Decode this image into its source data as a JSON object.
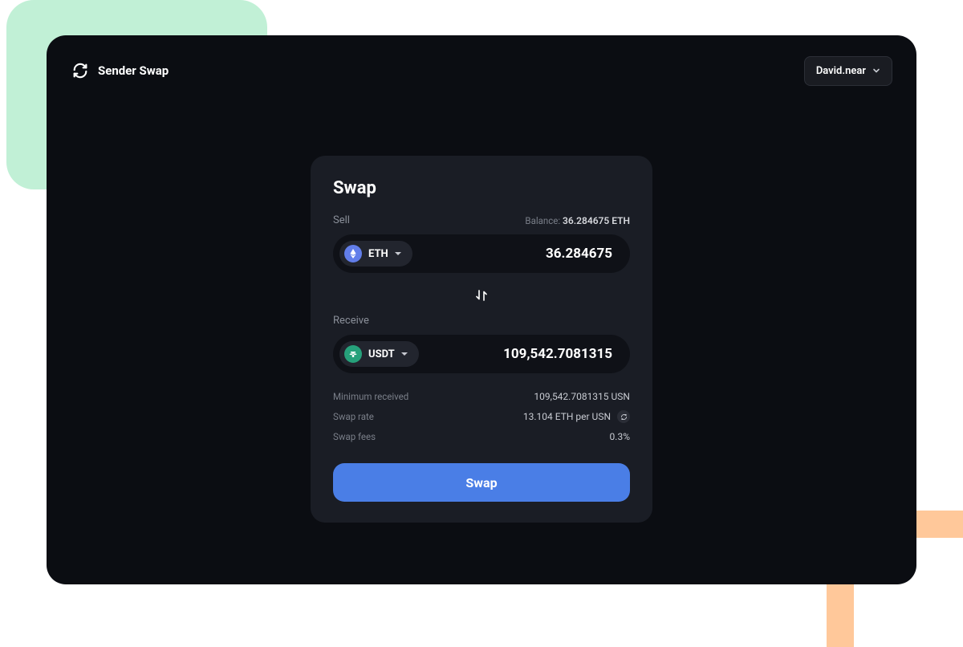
{
  "header": {
    "app_title": "Sender Swap",
    "account_label": "David.near"
  },
  "swap": {
    "title": "Swap",
    "sell": {
      "label": "Sell",
      "balance_label": "Balance:",
      "balance_value": "36.284675 ETH",
      "token_symbol": "ETH",
      "amount": "36.284675"
    },
    "receive": {
      "label": "Receive",
      "token_symbol": "USDT",
      "amount": "109,542.7081315"
    },
    "details": {
      "min_received_label": "Minimum received",
      "min_received_value": "109,542.7081315 USN",
      "swap_rate_label": "Swap rate",
      "swap_rate_value": "13.104 ETH per USN",
      "swap_fees_label": "Swap fees",
      "swap_fees_value": "0.3%"
    },
    "button_label": "Swap"
  }
}
